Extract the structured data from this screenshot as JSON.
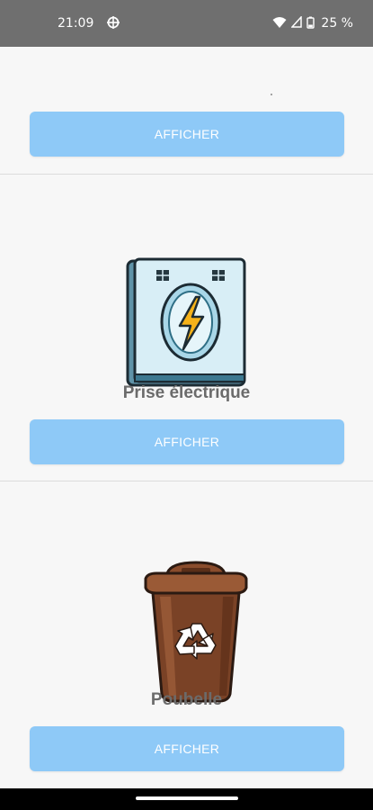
{
  "status_bar": {
    "time": "21:09",
    "battery": "25 %",
    "icons": [
      "crosshair-icon",
      "wifi-icon",
      "signal-icon",
      "battery-icon"
    ]
  },
  "items": [
    {
      "title": "",
      "button_label": "AFFICHER"
    },
    {
      "title": "Prise électrique",
      "button_label": "AFFICHER",
      "image": "electrical-outlet-icon"
    },
    {
      "title": "Poubelle",
      "button_label": "AFFICHER",
      "image": "recycle-bin-icon"
    }
  ],
  "colors": {
    "button": "#8ec9f7",
    "button_text": "#ffffff",
    "title_text": "#6b6b6b",
    "status_bar": "#6f6f6f",
    "background": "#f7f7f7"
  }
}
